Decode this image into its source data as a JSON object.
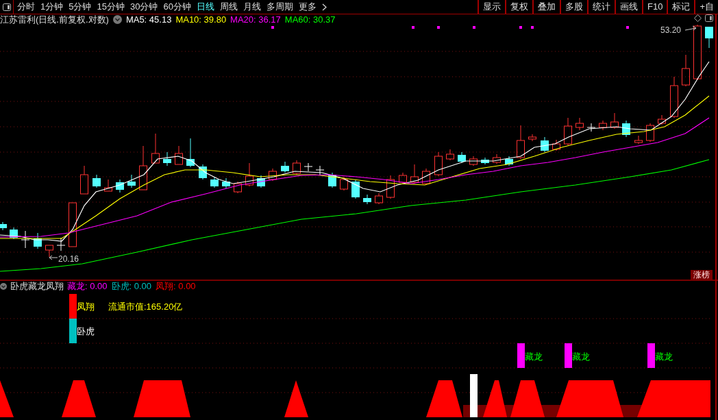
{
  "toolbar": {
    "periods": [
      {
        "label": "分时",
        "selected": false
      },
      {
        "label": "1分钟",
        "selected": false
      },
      {
        "label": "5分钟",
        "selected": false
      },
      {
        "label": "15分钟",
        "selected": false
      },
      {
        "label": "30分钟",
        "selected": false
      },
      {
        "label": "60分钟",
        "selected": false
      },
      {
        "label": "日线",
        "selected": true
      },
      {
        "label": "周线",
        "selected": false
      },
      {
        "label": "月线",
        "selected": false
      },
      {
        "label": "多周期",
        "selected": false
      }
    ],
    "more": "更多",
    "buttons": [
      "显示",
      "复权",
      "叠加",
      "多股",
      "统计",
      "画线",
      "F10",
      "标记",
      "+自"
    ]
  },
  "chart": {
    "title": "江苏雷利(日线.前复权.对数)",
    "ma": [
      {
        "label": "MA5: 45.13",
        "color": "#ffffff"
      },
      {
        "label": "MA10: 39.80",
        "color": "#ffff00"
      },
      {
        "label": "MA20: 36.17",
        "color": "#ff00ff"
      },
      {
        "label": "MA60: 30.37",
        "color": "#00ff00"
      }
    ],
    "high_label": "53.20",
    "low_label": "20.16",
    "badge": "涨榜"
  },
  "indicator": {
    "name": "卧虎藏龙凤翔",
    "values": [
      {
        "label": "藏龙: 0.00",
        "color": "#ff00ff"
      },
      {
        "label": "卧虎: 0.00",
        "color": "#00c0c0"
      },
      {
        "label": "凤翔: 0.00",
        "color": "#ff0000"
      }
    ],
    "legend": [
      {
        "text": "凤翔",
        "color": "#ff0000"
      },
      {
        "text": "卧虎",
        "color": "#00c0c0"
      }
    ],
    "market_cap": "流通市值:165.20亿",
    "signals": [
      {
        "text": "藏龙"
      },
      {
        "text": "藏龙"
      },
      {
        "text": "藏龙"
      }
    ]
  }
}
